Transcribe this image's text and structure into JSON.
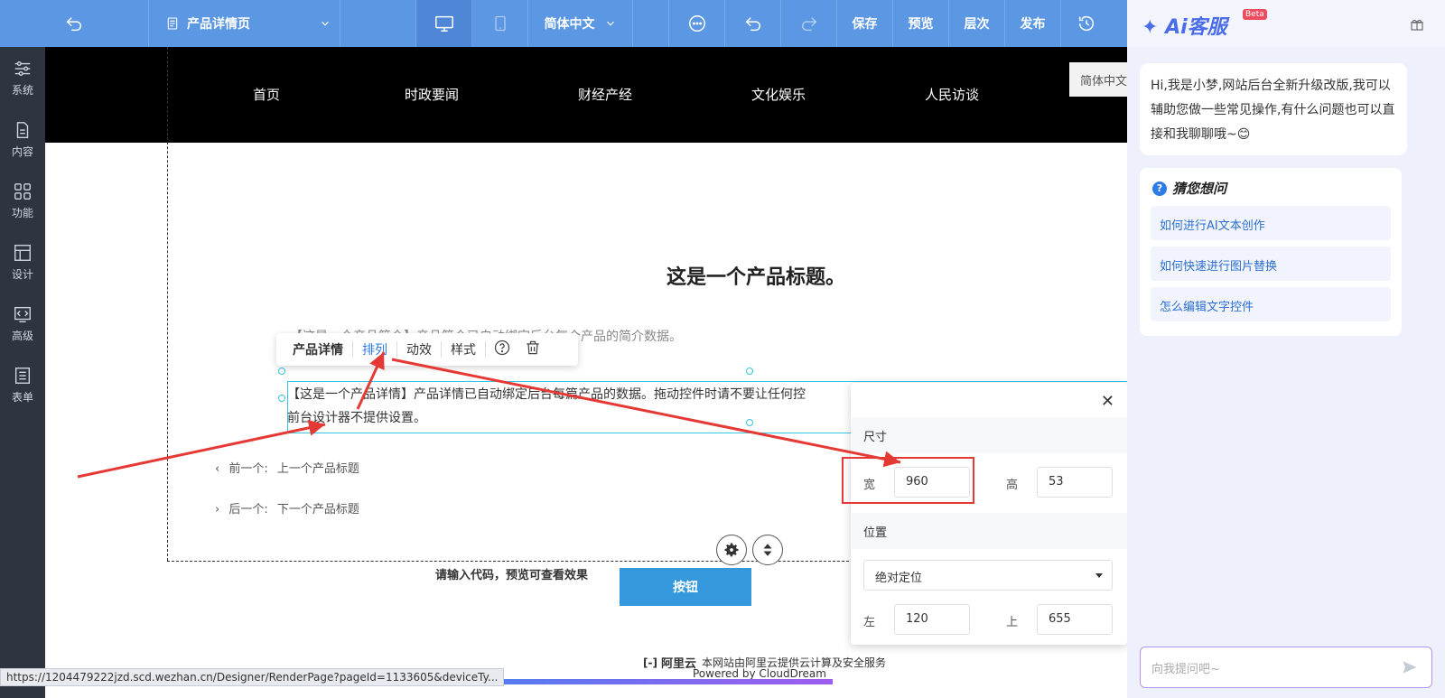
{
  "toolbar": {
    "page_name": "产品详情页",
    "language": "简体中文",
    "save": "保存",
    "preview": "预览",
    "layers": "层次",
    "publish": "发布"
  },
  "sidebar": {
    "items": [
      {
        "label": "系统",
        "icon": "sliders-icon"
      },
      {
        "label": "内容",
        "icon": "document-icon"
      },
      {
        "label": "功能",
        "icon": "grid-icon"
      },
      {
        "label": "设计",
        "icon": "layout-icon"
      },
      {
        "label": "高级",
        "icon": "code-icon"
      },
      {
        "label": "表单",
        "icon": "form-icon"
      }
    ]
  },
  "canvas": {
    "nav": [
      "首页",
      "时政要闻",
      "财经产经",
      "文化娱乐",
      "人民访谈"
    ],
    "lang_box": "简体中文",
    "product_title": "这是一个产品标题。",
    "product_intro": "【这是一个产品简介】产品简介已自动绑定后台每个产品的简介数据。",
    "detail_line1": "【这是一个产品详情】产品详情已自动绑定后台每篇产品的数据。拖动控件时请不要让任何控",
    "detail_line2": "前台设计器不提供设置。",
    "context_menu": {
      "title": "产品详情",
      "arrange": "排列",
      "animation": "动效",
      "style": "样式"
    },
    "prev_label": "前一个:",
    "prev_title": "上一个产品标题",
    "next_label": "后一个:",
    "next_title": "下一个产品标题",
    "code_hint": "请输入代码，预览可查看效果",
    "button_label": "按钮",
    "footer_brand": "阿里云",
    "footer_text": "本网站由阿里云提供云计算及安全服务",
    "footer_powered": "Powered by CloudDream",
    "status_url": "https://1204479222jzd.scd.wezhan.cn/Designer/RenderPage?pageId=1133605&deviceTy..."
  },
  "size_panel": {
    "size_section": "尺寸",
    "width_label": "宽",
    "width_value": "960",
    "height_label": "高",
    "height_value": "53",
    "position_section": "位置",
    "position_mode": "绝对定位",
    "left_label": "左",
    "left_value": "120",
    "top_label": "上",
    "top_value": "655"
  },
  "ai_panel": {
    "logo": "Ai客服",
    "badge": "Beta",
    "greeting": "Hi,我是小梦,网站后台全新升级改版,我可以辅助您做一些常见操作,有什么问题也可以直接和我聊聊哦~😊",
    "suggest_title": "猜您想问",
    "suggestions": [
      "如何进行AI文本创作",
      "如何快速进行图片替换",
      "怎么编辑文字控件"
    ],
    "input_placeholder": "向我提问吧~"
  },
  "colors": {
    "toolbar": "#5b97e3",
    "sidebar": "#2f3540",
    "accent": "#2d7be5",
    "annotation": "#e53935"
  }
}
